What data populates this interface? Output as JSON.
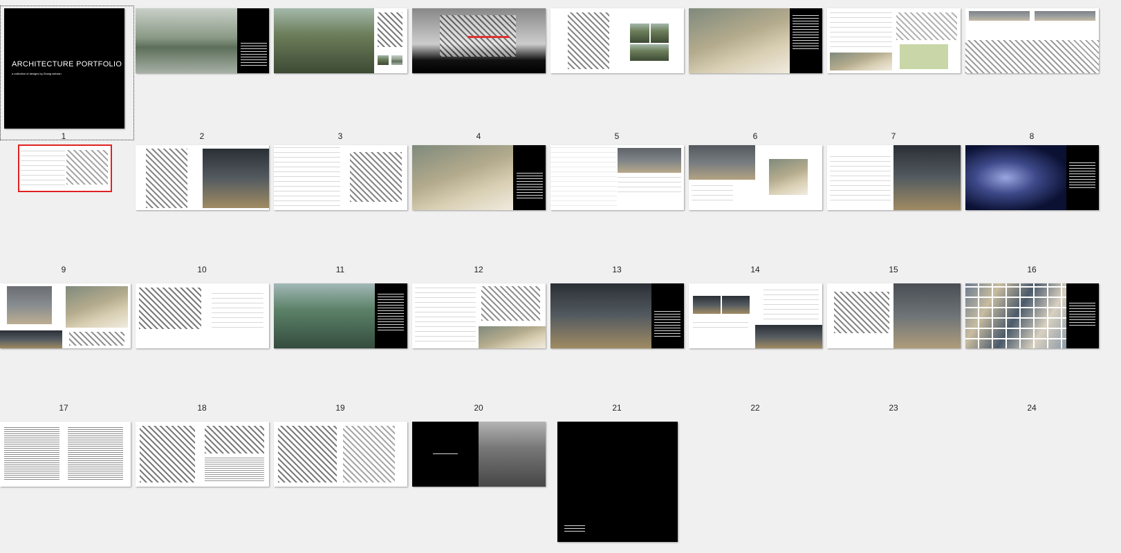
{
  "colors": {
    "background": "#f0f0f0",
    "selection_border": "#e02020",
    "page_black": "#000000"
  },
  "cover": {
    "title": "ARCHITECTURE PORTFOLIO",
    "subtitle": "a collection of designs by Zhang weixian"
  },
  "selection": {
    "selected_page": 1,
    "inline_thumbnail_selected": true
  },
  "page_numbers": [
    "1",
    "2",
    "3",
    "4",
    "5",
    "6",
    "7",
    "8",
    "9",
    "10",
    "11",
    "12",
    "13",
    "14",
    "15",
    "16",
    "17",
    "18",
    "19",
    "20",
    "21",
    "22",
    "23",
    "24"
  ]
}
